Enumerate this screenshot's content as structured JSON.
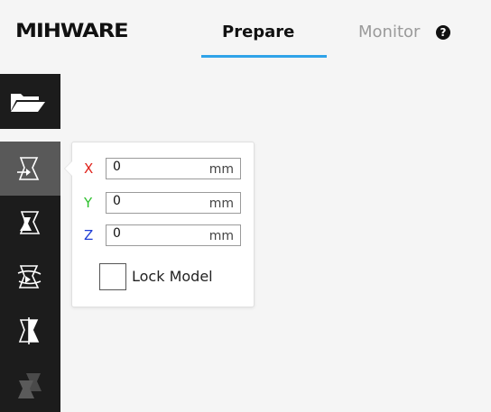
{
  "header": {
    "logo": "MIHWARE",
    "tabs": [
      {
        "label": "Prepare",
        "active": true
      },
      {
        "label": "Monitor",
        "active": false
      }
    ],
    "help_icon": "question-circle-icon",
    "accent_color": "#2fa3e8"
  },
  "sidebar": {
    "open_icon": "folder-open-icon",
    "tools": [
      {
        "icon": "move-icon",
        "active": true
      },
      {
        "icon": "scale-icon",
        "active": false
      },
      {
        "icon": "rotate-icon",
        "active": false
      },
      {
        "icon": "mirror-icon",
        "active": false
      },
      {
        "icon": "multiply-icon",
        "active": false,
        "disabled": true
      }
    ]
  },
  "move_panel": {
    "fields": [
      {
        "axis": "X",
        "value": "0",
        "unit": "mm",
        "color": "#e0221b"
      },
      {
        "axis": "Y",
        "value": "0",
        "unit": "mm",
        "color": "#2dc02d"
      },
      {
        "axis": "Z",
        "value": "0",
        "unit": "mm",
        "color": "#1f3ed6"
      }
    ],
    "lock_label": "Lock Model",
    "lock_checked": false
  }
}
